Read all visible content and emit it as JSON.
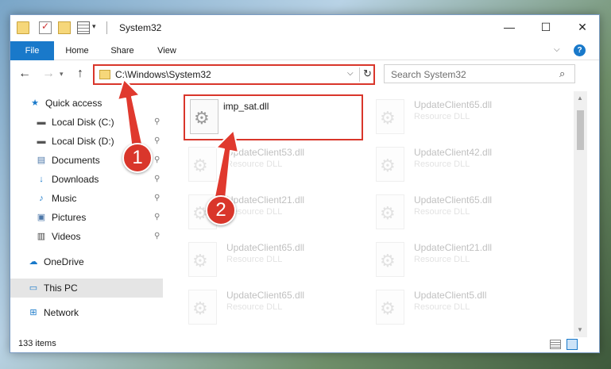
{
  "window": {
    "title": "System32",
    "controls": {
      "minimize": "—",
      "maximize": "☐",
      "close": "✕"
    }
  },
  "ribbon": {
    "tabs": [
      "File",
      "Home",
      "Share",
      "View"
    ],
    "help": "?"
  },
  "address": {
    "path": "C:\\Windows\\System32"
  },
  "search": {
    "placeholder": "Search System32"
  },
  "sidebar": {
    "quick_access": "Quick access",
    "items": [
      {
        "label": "Local Disk (C:)",
        "icon": "drive-icon"
      },
      {
        "label": "Local Disk (D:)",
        "icon": "drive-icon"
      },
      {
        "label": "Documents",
        "icon": "documents-icon"
      },
      {
        "label": "Downloads",
        "icon": "downloads-icon"
      },
      {
        "label": "Music",
        "icon": "music-icon"
      },
      {
        "label": "Pictures",
        "icon": "pictures-icon"
      },
      {
        "label": "Videos",
        "icon": "videos-icon"
      }
    ],
    "onedrive": "OneDrive",
    "this_pc": "This PC",
    "network": "Network"
  },
  "files": [
    {
      "name": "imp_sat.dll",
      "type": "",
      "selected": true
    },
    {
      "name": "UpdateClient65.dll",
      "type": "Resource DLL"
    },
    {
      "name": "UpdateClient53.dll",
      "type": "Resource DLL"
    },
    {
      "name": "UpdateClient42.dll",
      "type": "Resource DLL"
    },
    {
      "name": "UpdateClient21.dll",
      "type": "Resource DLL"
    },
    {
      "name": "UpdateClient65.dll",
      "type": "Resource DLL"
    },
    {
      "name": "UpdateClient65.dll",
      "type": "Resource DLL"
    },
    {
      "name": "UpdateClient21.dll",
      "type": "Resource DLL"
    },
    {
      "name": "UpdateClient65.dll",
      "type": "Resource DLL"
    },
    {
      "name": "UpdateClient5.dll",
      "type": "Resource DLL"
    }
  ],
  "status": {
    "item_count": "133 items"
  },
  "annotations": {
    "step1": "1",
    "step2": "2"
  },
  "colors": {
    "accent": "#1979ca",
    "highlight": "#d9362b"
  }
}
